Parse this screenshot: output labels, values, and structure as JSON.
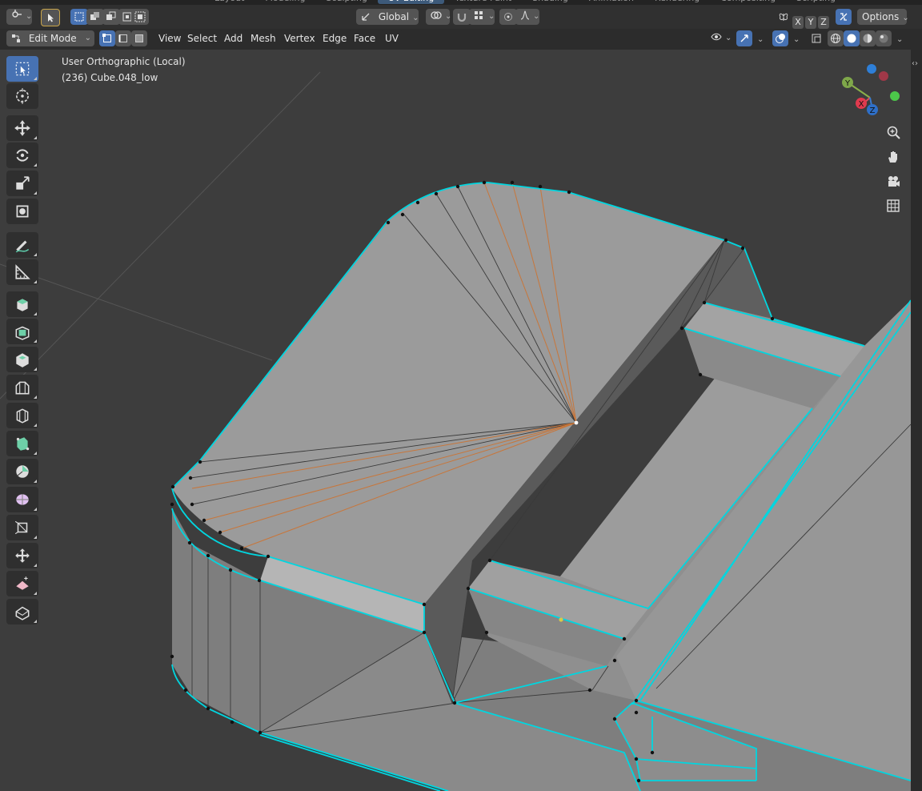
{
  "workspace_tabs": [
    "Layout",
    "Modeling",
    "Sculpting",
    "UV Editing",
    "Texture Paint",
    "Shading",
    "Animation",
    "Rendering",
    "Compositing",
    "Scripting"
  ],
  "active_workspace": "UV Editing",
  "header": {
    "transform_orientation": "Global",
    "axis_x": "X",
    "axis_y": "Y",
    "axis_z": "Z",
    "options_label": "Options"
  },
  "edit_header": {
    "mode": "Edit Mode",
    "menus": [
      "View",
      "Select",
      "Add",
      "Mesh",
      "Vertex",
      "Edge",
      "Face",
      "UV"
    ]
  },
  "viewport": {
    "view_name": "User Orthographic (Local)",
    "object_info": "(236) Cube.048_low"
  },
  "gizmo": {
    "y_label": "Y",
    "x_label": "X",
    "z_label": "Z"
  },
  "colors": {
    "accent": "#4772b3",
    "seam": "#00d8e0",
    "selected_edge": "#d07a30",
    "mesh_face": "#9a9a9a",
    "mesh_side": "#7a7a7a"
  },
  "tools": [
    {
      "name": "select-box-tool",
      "icon": "cursor-box-icon"
    },
    {
      "name": "cursor-tool",
      "icon": "crosshair-icon"
    },
    {
      "name": "move-tool",
      "icon": "move-arrows-icon"
    },
    {
      "name": "rotate-tool",
      "icon": "rotate-icon"
    },
    {
      "name": "scale-tool",
      "icon": "scale-icon"
    },
    {
      "name": "transform-tool",
      "icon": "transform-icon"
    },
    {
      "name": "annotate-tool",
      "icon": "pencil-icon"
    },
    {
      "name": "measure-tool",
      "icon": "ruler-icon"
    },
    {
      "name": "add-cube-tool",
      "icon": "cube-add-icon"
    },
    {
      "name": "extrude-tool",
      "icon": "extrude-icon"
    },
    {
      "name": "inset-tool",
      "icon": "inset-icon"
    },
    {
      "name": "bevel-tool",
      "icon": "bevel-icon"
    },
    {
      "name": "loop-cut-tool",
      "icon": "loop-cut-icon"
    },
    {
      "name": "knife-tool",
      "icon": "knife-icon"
    },
    {
      "name": "poly-build-tool",
      "icon": "poly-build-icon"
    },
    {
      "name": "spin-tool",
      "icon": "spin-icon"
    },
    {
      "name": "smooth-tool",
      "icon": "smooth-icon"
    },
    {
      "name": "edge-slide-tool",
      "icon": "edge-slide-icon"
    },
    {
      "name": "shrink-fatten-tool",
      "icon": "shrink-icon"
    },
    {
      "name": "shear-tool",
      "icon": "shear-icon"
    },
    {
      "name": "rip-tool",
      "icon": "rip-icon"
    }
  ]
}
